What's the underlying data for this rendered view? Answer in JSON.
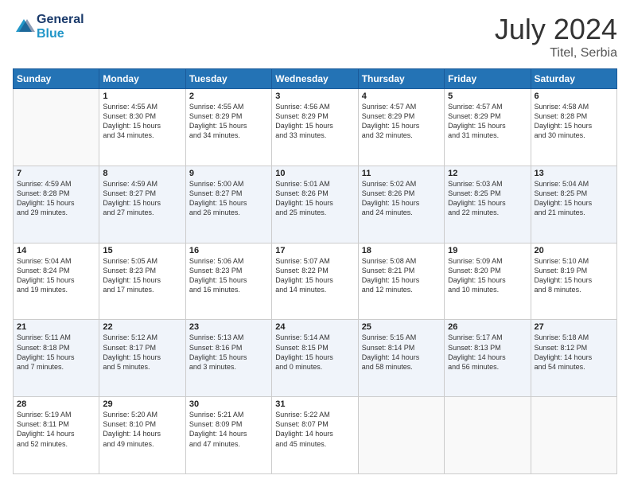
{
  "header": {
    "logo_general": "General",
    "logo_blue": "Blue",
    "month_year": "July 2024",
    "location": "Titel, Serbia"
  },
  "days_of_week": [
    "Sunday",
    "Monday",
    "Tuesday",
    "Wednesday",
    "Thursday",
    "Friday",
    "Saturday"
  ],
  "weeks": [
    [
      {
        "day": "",
        "info": ""
      },
      {
        "day": "1",
        "info": "Sunrise: 4:55 AM\nSunset: 8:30 PM\nDaylight: 15 hours\nand 34 minutes."
      },
      {
        "day": "2",
        "info": "Sunrise: 4:55 AM\nSunset: 8:29 PM\nDaylight: 15 hours\nand 34 minutes."
      },
      {
        "day": "3",
        "info": "Sunrise: 4:56 AM\nSunset: 8:29 PM\nDaylight: 15 hours\nand 33 minutes."
      },
      {
        "day": "4",
        "info": "Sunrise: 4:57 AM\nSunset: 8:29 PM\nDaylight: 15 hours\nand 32 minutes."
      },
      {
        "day": "5",
        "info": "Sunrise: 4:57 AM\nSunset: 8:29 PM\nDaylight: 15 hours\nand 31 minutes."
      },
      {
        "day": "6",
        "info": "Sunrise: 4:58 AM\nSunset: 8:28 PM\nDaylight: 15 hours\nand 30 minutes."
      }
    ],
    [
      {
        "day": "7",
        "info": "Sunrise: 4:59 AM\nSunset: 8:28 PM\nDaylight: 15 hours\nand 29 minutes."
      },
      {
        "day": "8",
        "info": "Sunrise: 4:59 AM\nSunset: 8:27 PM\nDaylight: 15 hours\nand 27 minutes."
      },
      {
        "day": "9",
        "info": "Sunrise: 5:00 AM\nSunset: 8:27 PM\nDaylight: 15 hours\nand 26 minutes."
      },
      {
        "day": "10",
        "info": "Sunrise: 5:01 AM\nSunset: 8:26 PM\nDaylight: 15 hours\nand 25 minutes."
      },
      {
        "day": "11",
        "info": "Sunrise: 5:02 AM\nSunset: 8:26 PM\nDaylight: 15 hours\nand 24 minutes."
      },
      {
        "day": "12",
        "info": "Sunrise: 5:03 AM\nSunset: 8:25 PM\nDaylight: 15 hours\nand 22 minutes."
      },
      {
        "day": "13",
        "info": "Sunrise: 5:04 AM\nSunset: 8:25 PM\nDaylight: 15 hours\nand 21 minutes."
      }
    ],
    [
      {
        "day": "14",
        "info": "Sunrise: 5:04 AM\nSunset: 8:24 PM\nDaylight: 15 hours\nand 19 minutes."
      },
      {
        "day": "15",
        "info": "Sunrise: 5:05 AM\nSunset: 8:23 PM\nDaylight: 15 hours\nand 17 minutes."
      },
      {
        "day": "16",
        "info": "Sunrise: 5:06 AM\nSunset: 8:23 PM\nDaylight: 15 hours\nand 16 minutes."
      },
      {
        "day": "17",
        "info": "Sunrise: 5:07 AM\nSunset: 8:22 PM\nDaylight: 15 hours\nand 14 minutes."
      },
      {
        "day": "18",
        "info": "Sunrise: 5:08 AM\nSunset: 8:21 PM\nDaylight: 15 hours\nand 12 minutes."
      },
      {
        "day": "19",
        "info": "Sunrise: 5:09 AM\nSunset: 8:20 PM\nDaylight: 15 hours\nand 10 minutes."
      },
      {
        "day": "20",
        "info": "Sunrise: 5:10 AM\nSunset: 8:19 PM\nDaylight: 15 hours\nand 8 minutes."
      }
    ],
    [
      {
        "day": "21",
        "info": "Sunrise: 5:11 AM\nSunset: 8:18 PM\nDaylight: 15 hours\nand 7 minutes."
      },
      {
        "day": "22",
        "info": "Sunrise: 5:12 AM\nSunset: 8:17 PM\nDaylight: 15 hours\nand 5 minutes."
      },
      {
        "day": "23",
        "info": "Sunrise: 5:13 AM\nSunset: 8:16 PM\nDaylight: 15 hours\nand 3 minutes."
      },
      {
        "day": "24",
        "info": "Sunrise: 5:14 AM\nSunset: 8:15 PM\nDaylight: 15 hours\nand 0 minutes."
      },
      {
        "day": "25",
        "info": "Sunrise: 5:15 AM\nSunset: 8:14 PM\nDaylight: 14 hours\nand 58 minutes."
      },
      {
        "day": "26",
        "info": "Sunrise: 5:17 AM\nSunset: 8:13 PM\nDaylight: 14 hours\nand 56 minutes."
      },
      {
        "day": "27",
        "info": "Sunrise: 5:18 AM\nSunset: 8:12 PM\nDaylight: 14 hours\nand 54 minutes."
      }
    ],
    [
      {
        "day": "28",
        "info": "Sunrise: 5:19 AM\nSunset: 8:11 PM\nDaylight: 14 hours\nand 52 minutes."
      },
      {
        "day": "29",
        "info": "Sunrise: 5:20 AM\nSunset: 8:10 PM\nDaylight: 14 hours\nand 49 minutes."
      },
      {
        "day": "30",
        "info": "Sunrise: 5:21 AM\nSunset: 8:09 PM\nDaylight: 14 hours\nand 47 minutes."
      },
      {
        "day": "31",
        "info": "Sunrise: 5:22 AM\nSunset: 8:07 PM\nDaylight: 14 hours\nand 45 minutes."
      },
      {
        "day": "",
        "info": ""
      },
      {
        "day": "",
        "info": ""
      },
      {
        "day": "",
        "info": ""
      }
    ]
  ]
}
